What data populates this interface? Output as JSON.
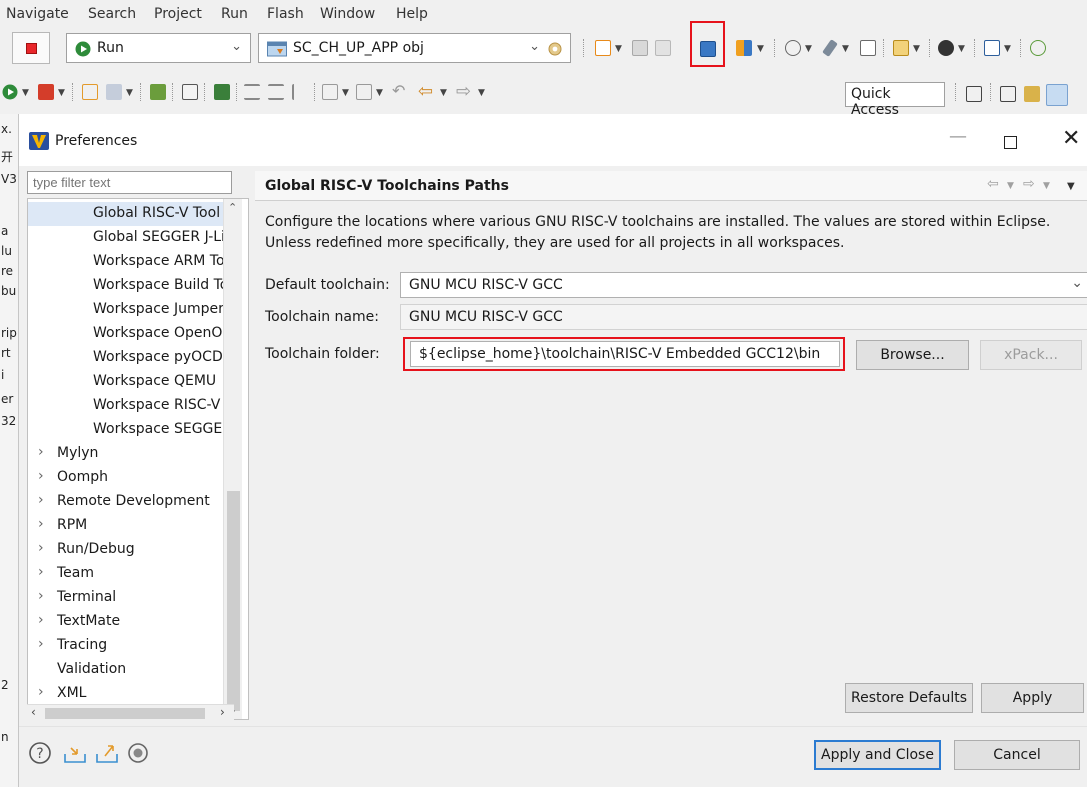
{
  "menu": [
    "Navigate",
    "Search",
    "Project",
    "Run",
    "Flash",
    "Window",
    "Help"
  ],
  "toolbar": {
    "run_config": "Run",
    "project_config": "SC_CH_UP_APP obj",
    "quick_access": "Quick Access"
  },
  "ide_left_strip": [
    "x.",
    "开",
    "V3",
    "a",
    "lu",
    "re",
    "bu",
    "rip",
    "rt",
    "i",
    "er",
    "32",
    "2",
    "n"
  ],
  "dialog": {
    "title": "Preferences",
    "filter_placeholder": "type filter text",
    "tree": [
      {
        "label": "Global RISC-V Tool",
        "indent": 2,
        "selected": true
      },
      {
        "label": "Global SEGGER J-Li",
        "indent": 2
      },
      {
        "label": "Workspace ARM To",
        "indent": 2
      },
      {
        "label": "Workspace Build To",
        "indent": 2
      },
      {
        "label": "Workspace Jumper",
        "indent": 2
      },
      {
        "label": "Workspace OpenO",
        "indent": 2
      },
      {
        "label": "Workspace pyOCD",
        "indent": 2
      },
      {
        "label": "Workspace QEMU",
        "indent": 2
      },
      {
        "label": "Workspace RISC-V",
        "indent": 2
      },
      {
        "label": "Workspace SEGGEI",
        "indent": 2
      },
      {
        "label": "Mylyn",
        "indent": 1,
        "expandable": true
      },
      {
        "label": "Oomph",
        "indent": 1,
        "expandable": true
      },
      {
        "label": "Remote Development",
        "indent": 1,
        "expandable": true
      },
      {
        "label": "RPM",
        "indent": 1,
        "expandable": true
      },
      {
        "label": "Run/Debug",
        "indent": 1,
        "expandable": true
      },
      {
        "label": "Team",
        "indent": 1,
        "expandable": true
      },
      {
        "label": "Terminal",
        "indent": 1,
        "expandable": true
      },
      {
        "label": "TextMate",
        "indent": 1,
        "expandable": true
      },
      {
        "label": "Tracing",
        "indent": 1,
        "expandable": true
      },
      {
        "label": "Validation",
        "indent": 1
      },
      {
        "label": "XML",
        "indent": 1,
        "expandable": true
      }
    ],
    "page": {
      "title": "Global RISC-V Toolchains Paths",
      "description": "Configure the locations where various GNU RISC-V toolchains are installed. The values are stored within Eclipse. Unless redefined more specifically, they are used for all projects in all workspaces.",
      "default_toolchain_label": "Default toolchain:",
      "default_toolchain_value": "GNU MCU RISC-V GCC",
      "toolchain_name_label": "Toolchain name:",
      "toolchain_name_value": "GNU MCU RISC-V GCC",
      "toolchain_folder_label": "Toolchain folder:",
      "toolchain_folder_value": "${eclipse_home}\\toolchain\\RISC-V Embedded GCC12\\bin",
      "browse_label": "Browse...",
      "xpack_label": "xPack...",
      "restore_defaults_label": "Restore Defaults",
      "apply_label": "Apply"
    },
    "apply_close_label": "Apply and Close",
    "cancel_label": "Cancel"
  },
  "colors": {
    "highlight_box": "#e6121b",
    "selection": "#dde8f6",
    "default_button_border": "#2b7bd1"
  }
}
